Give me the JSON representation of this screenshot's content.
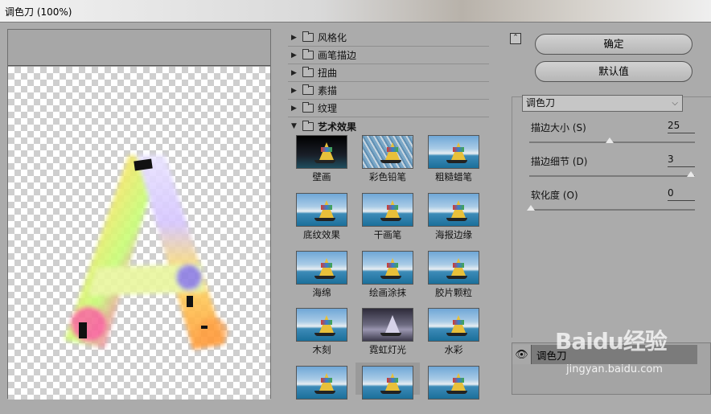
{
  "window": {
    "title": "调色刀 (100%)"
  },
  "categories": [
    {
      "label": "风格化",
      "icon": "folder-icon",
      "open": false
    },
    {
      "label": "画笔描边",
      "icon": "folder-icon",
      "open": false
    },
    {
      "label": "扭曲",
      "icon": "folder-icon",
      "open": false
    },
    {
      "label": "素描",
      "icon": "folder-icon",
      "open": false
    },
    {
      "label": "纹理",
      "icon": "folder-icon",
      "open": false
    },
    {
      "label": "艺术效果",
      "icon": "folder-icon",
      "open": true
    }
  ],
  "thumbnails": [
    {
      "label": "壁画"
    },
    {
      "label": "彩色铅笔"
    },
    {
      "label": "粗糙蜡笔"
    },
    {
      "label": "底纹效果"
    },
    {
      "label": "干画笔"
    },
    {
      "label": "海报边缘"
    },
    {
      "label": "海绵"
    },
    {
      "label": "绘画涂抹"
    },
    {
      "label": "胶片颗粒"
    },
    {
      "label": "木刻"
    },
    {
      "label": "霓虹灯光"
    },
    {
      "label": "水彩"
    }
  ],
  "buttons": {
    "ok": "确定",
    "default": "默认值"
  },
  "filter_select": {
    "value": "调色刀"
  },
  "params": [
    {
      "label": "描边大小 (S)",
      "value": "25",
      "level": 0.5
    },
    {
      "label": "描边细节 (D)",
      "value": "3",
      "level": 1.0
    },
    {
      "label": "软化度 (O)",
      "value": "0",
      "level": 0.0
    }
  ],
  "layers": [
    {
      "name": "调色刀",
      "visible": true
    }
  ],
  "watermark": {
    "logo": "Baidu经验",
    "url": "jingyan.baidu.com"
  }
}
